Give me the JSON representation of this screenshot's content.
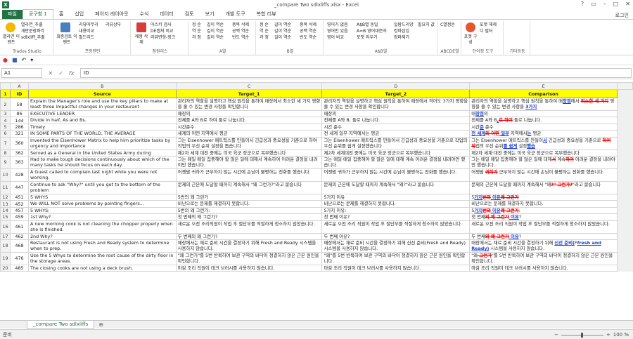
{
  "window": {
    "title": "_compare Two sdlxliffs.xlsx - Excel",
    "user": "로그인"
  },
  "tabs": [
    "파일",
    "공구함 1",
    "홈",
    "삽입",
    "페이지 레이아웃",
    "수식",
    "데이터",
    "검토",
    "보기",
    "개발 도구",
    "복합 리뷰"
  ],
  "ribbon": {
    "groups": [
      {
        "label": "Trados Studio",
        "buttons": [
          "열라연_추출",
          "개반문장파악",
          "sdlxliff_추출"
        ],
        "big": "열라연 이벤트"
      },
      {
        "label": "프랑켄틴",
        "buttons": [
          "리뷰마무리",
          "리뷰상부",
          "내용비교",
          "필드리드"
        ],
        "big": "최종검토 이벤트"
      },
      {
        "label": "점원리스",
        "buttons": [
          "아스키 검사",
          "DE캡쳐 비교",
          "리뷰변형-링크"
        ],
        "big": "깨형 삭제"
      },
      {
        "label": "A열",
        "buttons": [
          "정 순",
          "역 순",
          "과 정",
          "길이 역순",
          "길이 역순",
          "길이 역순",
          "중복 삭제",
          "공백 역순",
          "빈도 역순"
        ]
      },
      {
        "label": "B열",
        "buttons": [
          "정 순",
          "역 순",
          "과 정",
          "길이 역순",
          "길이 역순",
          "길이 역순",
          "중복 삭제",
          "공백 역순",
          "빈도 역순"
        ]
      },
      {
        "label": "A$B열",
        "buttons": [
          "영어가 없음",
          "영어만 있음",
          "영어 비교",
          "A$B열 동일",
          "A=B 영어대문자",
          "포맷 지우기",
          "일람드리앙",
          "컴마삽입",
          "컴마제거",
          "필요치 값"
        ]
      },
      {
        "label": "ABCDE열",
        "buttons": [
          "C열정순"
        ]
      },
      {
        "label": "단어장 도구",
        "buttons": [
          "포맷 해제",
          "디 필터"
        ],
        "big": "포맷 구성"
      },
      {
        "label": "기타등등",
        "buttons": []
      }
    ]
  },
  "namebox": "A1",
  "formula": "ID",
  "columns": [
    "A",
    "B",
    "C",
    "D",
    "E"
  ],
  "header": {
    "id": "ID",
    "source": "Source",
    "target1": "Target_1",
    "target2": "Target_2",
    "comparison": "Comparison"
  },
  "rows": [
    {
      "row": "2",
      "id": "58",
      "tall": true,
      "source": "Explain the Manager's role and use the key pillars to make at least three impactful changes in your restaurant",
      "t1": "관리자의 역할을 설명하고 핵심 원칙을 통하여 매장에서 최소한 세 가지 영향을 줄 수 있는 변경 사항을 확인합니다",
      "t2": "관리자의 역할을 설명하고 핵심 원칙을 통하여 매장에서 적어도 3가지 영향을 줄 수 있는 변경 사항을 확인합니다",
      "cmp": [
        [
          "관리자의 역할을 설명하고 핵심 원칙을 통하여 매",
          "n"
        ],
        [
          "장점",
          "i"
        ],
        [
          "에서 ",
          "n"
        ],
        [
          "최소한 세 가지",
          "d"
        ],
        [
          " 영향을 줄 수 있는 변경 사항을 ",
          "n"
        ],
        [
          "3가지",
          "i"
        ]
      ]
    },
    {
      "row": "3",
      "id": "86",
      "source": "EXECUTIVE LEADER",
      "t1": "매장의",
      "t2": "매장의",
      "cmp": [
        [
          "매",
          "n"
        ],
        [
          "장점",
          "i"
        ],
        [
          "의",
          "n"
        ]
      ]
    },
    {
      "row": "4",
      "id": "144",
      "source": "Divide in half, As and Bs.",
      "t1": "전체를 A와 B로 하여 둘로 나눕니다.",
      "t2": "전체를 A와 B, 둘로 나눕니다.",
      "cmp": [
        [
          "전체를 A와 B",
          "n"
        ],
        [
          ",",
          "i"
        ],
        [
          "로 하여",
          "d"
        ],
        [
          " 둘로 나눕니다.",
          "n"
        ]
      ]
    },
    {
      "row": "5",
      "id": "286",
      "source": "Timely",
      "t1": "시간준수",
      "t2": "시간 준수",
      "cmp": [
        [
          "시간",
          "n"
        ],
        [
          "준",
          "i"
        ],
        [
          " 준수",
          "n"
        ]
      ]
    },
    {
      "row": "6",
      "id": "321",
      "source": "IN SOME PARTS OF THE WORLD, THE AVERAGE",
      "t1": "세계의 어떤 지역에서 평균",
      "t2": "전 세계 일부 지역에서는 평균",
      "cmp": [
        [
          "전 세계",
          "i"
        ],
        [
          "의 어떤",
          "d"
        ],
        [
          " 일부",
          "i"
        ],
        [
          " 지역에서",
          "n"
        ],
        [
          "는",
          "i"
        ],
        [
          " 평균",
          "n"
        ]
      ]
    },
    {
      "row": "7",
      "id": "360",
      "tall": true,
      "source": "Invented the Eisenhower Matrix to help him prioritize tasks by urgency and importance",
      "t1": "그는 Eisenhower 매트릭스를 만들어서 긴급성과 중요성을 기준으로 하여 작업의 우선 순위 설정을 돕습니다",
      "t2": "그는 Eisenhower 매트릭스를 만들어서 긴급성과 중요성을 기준으로 작업의 우선 순위를 쉽게 설정했습니다",
      "cmp": [
        [
          "그는 Eisenhower 매트릭스를 만들어",
          "n"
        ],
        [
          "서",
          "i"
        ],
        [
          " 긴급성과 중요성을 기준으로 ",
          "n"
        ],
        [
          "하여 작",
          "d"
        ],
        [
          "업의 우선 순위",
          "n"
        ],
        [
          "를 쉽게",
          "i"
        ],
        [
          " 설정",
          "n"
        ],
        [
          "했습",
          "i"
        ]
      ]
    },
    {
      "row": "8",
      "id": "362",
      "source": "Served as a General in the United States Army during",
      "t1": "제2차 세계 대전 중에는 미국 육군 장군으로 복무했습니다",
      "t2": "제2차 세계대전 중에는 미국 육군 장군으로 복무했습니다",
      "cmp": [
        [
          "제2차 세계·대전 중에는 미국 육군 장군으로 복무했습니다",
          "n"
        ]
      ]
    },
    {
      "row": "9",
      "id": "363",
      "tall": true,
      "source": "Had to make tough decisions continuously about which of the many tasks he should focus on each day.",
      "t1": "그는 매일 매일 집중해야 할 많은 일에 대해서 계속하여 어려운 결정을 내려야만 했습니다.",
      "t2": "그는 매일 매일 집중해야 할 많은 일에 대해 계속 어려운 결정을 내려야만 했습니다.",
      "cmp": [
        [
          "그는 매일 매일 집중해야 할 많은 일에 대해",
          "n"
        ],
        [
          "서",
          "d"
        ],
        [
          " 계속",
          "n"
        ],
        [
          "하여",
          "d"
        ],
        [
          " 어려운 결정을 내려야만 했습니다.",
          "n"
        ]
      ]
    },
    {
      "row": "10",
      "id": "428",
      "tall": true,
      "source": "A Guest called to complain last night while you were not working.",
      "t1": "어젯밤 귀하가 근무하지 않는 시간에 손님이 불평하는 전화를 했습니다.",
      "t2": "어젯밤 귀하가 근무하지 않는 시간에 손님이 불평하는 전화를 했습니다.",
      "cmp": [
        [
          "어젯밤 ",
          "n"
        ],
        [
          "귀하가",
          "d"
        ],
        [
          " 근무하지 않는 시간에 손님이 불평하는 전화를 했습니다.",
          "n"
        ]
      ]
    },
    {
      "row": "11",
      "id": "447",
      "tall": true,
      "source": "Continue to ask \"Why?\" until you get to the bottom of the problem",
      "t1": "문제의 근본에 도달할 때까지 계속해서 \"왜 그런가?\"라고 묻습니다",
      "t2": "문제의 근본에 도달할 때까지 계속해서 \"왜?\"라고 묻습니다",
      "cmp": [
        [
          "문제의 근본에 도달할 때까지 계속해서 \"왜",
          "n"
        ],
        [
          "?\" 그런가?",
          "d"
        ],
        [
          "\"라고 묻습니다",
          "n"
        ]
      ]
    },
    {
      "row": "12",
      "id": "451",
      "source": "5 WHYS",
      "t1": "5번의 왜 그런가",
      "t2": "5가지 이유",
      "cmp": [
        [
          "5",
          "n"
        ],
        [
          "가지",
          "i"
        ],
        [
          "번의",
          "d"
        ],
        [
          " 이유",
          "i"
        ],
        [
          "왜 그런가",
          "d"
        ]
      ]
    },
    {
      "row": "13",
      "id": "452",
      "source": "We WILL NOT solve problems by pointing fingers...",
      "t1": "비난으로는 문제를 해결하지 못합니다.",
      "t2": "비난으로는 문제를 해결하지 못합니다.",
      "cmp": [
        [
          "비난으로는 문제를 해결하지 못합니다.",
          "n"
        ]
      ]
    },
    {
      "row": "14",
      "id": "457",
      "source": "5 WHYS:",
      "t1": "5번의 왜 그런가:",
      "t2": "5가지 이유:",
      "cmp": [
        [
          "5",
          "n"
        ],
        [
          "가지",
          "i"
        ],
        [
          "번의",
          "d"
        ],
        [
          " 이유",
          "i"
        ],
        [
          "왜 그런가",
          "d"
        ],
        [
          ":",
          "n"
        ]
      ]
    },
    {
      "row": "15",
      "id": "459",
      "source": "1st Why?",
      "t1": "첫 번째의 왜 그런가?",
      "t2": "첫 번째 이유?",
      "cmp": [
        [
          "첫 번째",
          "n"
        ],
        [
          "의 왜 그런가",
          "d"
        ],
        [
          " 이유",
          "i"
        ],
        [
          "?",
          "n"
        ]
      ]
    },
    {
      "row": "16",
      "id": "461",
      "tall": true,
      "source": "A new morning cook is not cleaning the chopper properly when she is finished.",
      "t1": "새로운 오전 조리직원이 작업 후 절단부를 적절하게 청소하지 않았습니다.",
      "t2": "새로운 오전 조리 직원이 작업 후 절단부를 적절하게 청소하지 않았습니다.",
      "cmp": [
        [
          "새로운 오전 조리 직원이 작업 후 절단부를 적절하게 청소하지 않았습니다.",
          "n"
        ]
      ]
    },
    {
      "row": "17",
      "id": "462",
      "source": "2nd Why?",
      "t1": "두 번째의 왜 그런가?",
      "t2": "두 번째 이유?",
      "cmp": [
        [
          "두 번째",
          "n"
        ],
        [
          "의 왜 그런가",
          "d"
        ],
        [
          " 이유",
          "i"
        ],
        [
          "?",
          "n"
        ]
      ]
    },
    {
      "row": "18",
      "id": "468",
      "tall": true,
      "source": "Restaurant is not using Fresh and Ready system to determine when to prep.",
      "t1": "매장에서는 재료 준비 시간을 결정하기 위해 Fresh and Ready 시스템을 사용하지 않습니다.",
      "t2": "매장에서는 재료 준비 시간을 결정하기 위해 신선 준비(Fresh and Ready) 시스템을 사용하지 않습니다.",
      "cmp": [
        [
          "매장에서는 재료 준비 시간을 결정하기 위해 ",
          "n"
        ],
        [
          "신선 준비(",
          "i"
        ],
        [
          "F",
          "n"
        ],
        [
          "fresh and Ready)",
          "i"
        ],
        [
          " 시스템을 사용하지 않습니다.",
          "n"
        ]
      ]
    },
    {
      "row": "19",
      "id": "476",
      "tall": true,
      "source": "Use the 5 Whys to determine the root cause of the dirty floor in the storage areas.",
      "t1": "\"왜 그런가\"를 5번 반복하여 보관 구역의 바닥이 청결하지 않은 근본 원인을 확인합니다.",
      "t2": "\"왜\"를 5번 반복하여 보관 구역의 바닥이 청결하지 않은 근본 원인을 확인합니다.",
      "cmp": [
        [
          "\"왜",
          "n"
        ],
        [
          " 그런가",
          "d"
        ],
        [
          "\"를 5번 반복하여 보관 구역의 바닥이 청결하지 않은 근본 원인을 확인합니다.",
          "n"
        ]
      ]
    },
    {
      "row": "20",
      "id": "485",
      "source": "The closing cooks are not using a deck brush.",
      "t1": "마감 조리 직원이 데크 브러시를 사용하지 않습니다.",
      "t2": "마감 조리 직원이 데크 브러시를 사용하지 않습니다.",
      "cmp": [
        [
          "마감 조리 직원이 데크 브러시를 사용하지 않습니다.",
          "n"
        ]
      ]
    }
  ],
  "sheet": {
    "tab": "_compare Two sdlxliffs",
    "status": "준비",
    "zoom": "100 %"
  },
  "colors": {
    "excel_green": "#217346",
    "header_yellow": "#ffff00",
    "deleted": "#e00000",
    "inserted": "#1a3fd6"
  }
}
